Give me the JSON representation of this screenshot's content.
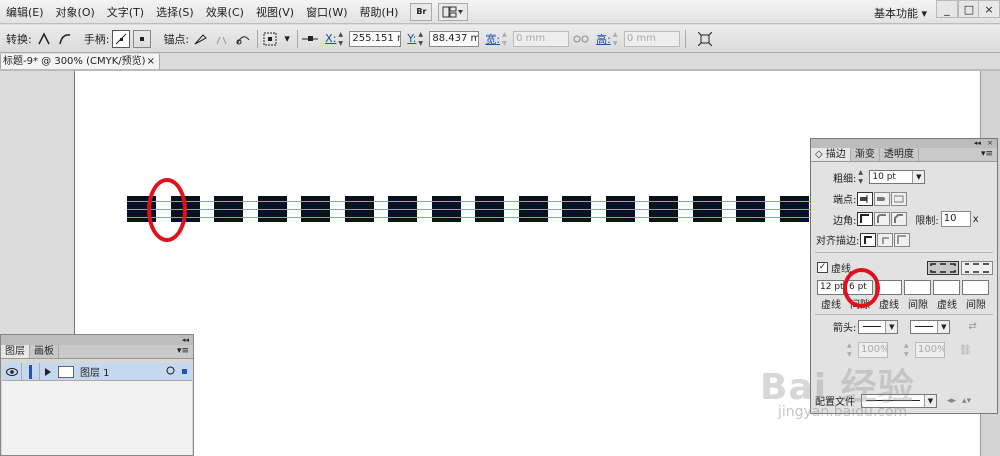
{
  "menubar": {
    "items": [
      "编辑(E)",
      "对象(O)",
      "文字(T)",
      "选择(S)",
      "效果(C)",
      "视图(V)",
      "窗口(W)",
      "帮助(H)"
    ],
    "bridge_label": "Br",
    "workspace": "基本功能",
    "window_controls": [
      "_",
      "□",
      "×"
    ]
  },
  "controlbar": {
    "convert_label": "转换:",
    "handles_label": "手柄:",
    "anchor_label": "锚点:",
    "x_label": "X:",
    "x_value": "255.151 r",
    "y_label": "Y:",
    "y_value": "88.437 mm",
    "width_label": "宽:",
    "width_value": "0 mm",
    "height_label": "高:",
    "height_value": "0 mm"
  },
  "document": {
    "tab_title": "标题-9* @ 300% (CMYK/预览)",
    "close": "×"
  },
  "layers_panel": {
    "collapse": "◂◂",
    "tabs": [
      "图层",
      "画板"
    ],
    "menu": "▾≡",
    "layers": [
      {
        "name": "图层 1"
      }
    ]
  },
  "stroke_panel": {
    "collapse": "◂◂",
    "close": "×",
    "tabs": [
      "◇ 描边",
      "渐变",
      "透明度"
    ],
    "menu": "▾≡",
    "weight_label": "粗细:",
    "weight_value": "10 pt",
    "cap_label": "端点:",
    "corner_label": "边角:",
    "limit_label": "限制:",
    "limit_value": "10",
    "limit_unit": "x",
    "align_label": "对齐描边:",
    "dashed_label": "虚线",
    "dash_fields": [
      {
        "value": "12 pt",
        "label": "虚线"
      },
      {
        "value": "6 pt",
        "label": "间隙"
      },
      {
        "value": "",
        "label": "虚线"
      },
      {
        "value": "",
        "label": "间隙"
      },
      {
        "value": "",
        "label": "虚线"
      },
      {
        "value": "",
        "label": "间隙"
      }
    ],
    "arrow_label": "箭头:",
    "scale_start": "100%",
    "scale_end": "100%",
    "profile_partial": "配置文件"
  },
  "watermark": {
    "brand": "Bai 经验",
    "url": "jingyan.baidu.com"
  },
  "colors": {
    "highlight": "#e0111b",
    "dash_fill": "#0b0f1c",
    "path_blue": "#6ea6ff"
  }
}
